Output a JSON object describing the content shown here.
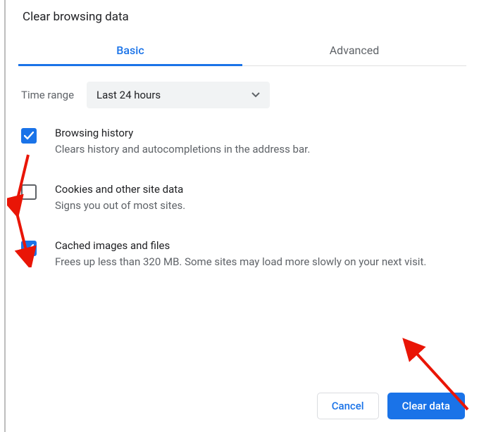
{
  "dialog": {
    "title": "Clear browsing data"
  },
  "tabs": {
    "basic": "Basic",
    "advanced": "Advanced"
  },
  "time_range": {
    "label": "Time range",
    "selected": "Last 24 hours"
  },
  "options": {
    "browsing_history": {
      "title": "Browsing history",
      "desc": "Clears history and autocompletions in the address bar.",
      "checked": true
    },
    "cookies": {
      "title": "Cookies and other site data",
      "desc": "Signs you out of most sites.",
      "checked": false
    },
    "cache": {
      "title": "Cached images and files",
      "desc": "Frees up less than 320 MB. Some sites may load more slowly on your next visit.",
      "checked": true
    }
  },
  "buttons": {
    "cancel": "Cancel",
    "clear": "Clear data"
  },
  "colors": {
    "accent": "#1a73e8",
    "annotation": "#e91506"
  }
}
